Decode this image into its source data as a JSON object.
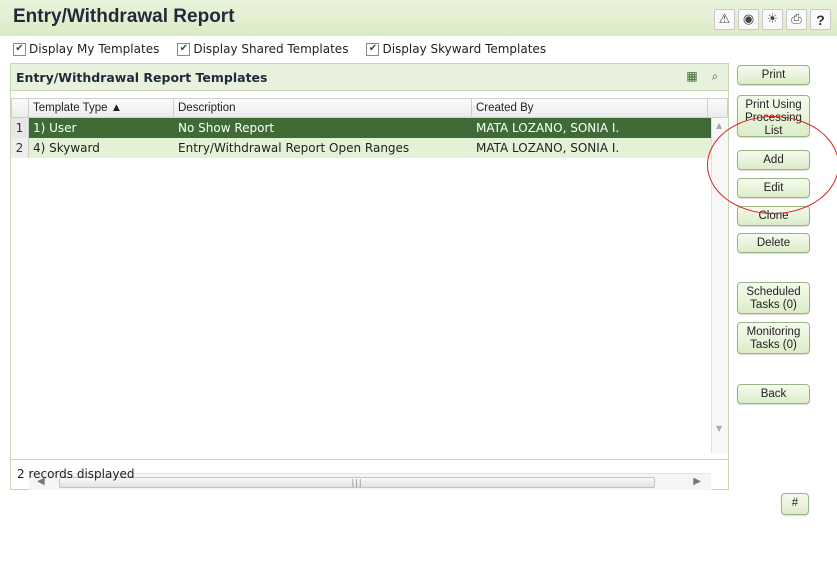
{
  "title": "Entry/Withdrawal Report",
  "toolbar_icons": [
    "alert-icon",
    "camera-icon",
    "lightbulb-icon",
    "printer-icon",
    "help-icon"
  ],
  "help_label": "?",
  "checkboxes": [
    {
      "label": "Display My Templates",
      "checked": true
    },
    {
      "label": "Display Shared Templates",
      "checked": true
    },
    {
      "label": "Display Skyward Templates",
      "checked": true
    }
  ],
  "panel": {
    "title": "Entry/Withdrawal Report Templates",
    "columns": [
      "Template Type ▲",
      "Description",
      "Created By"
    ],
    "rows": [
      {
        "num": "1",
        "type": "1) User",
        "description": "No Show Report",
        "created_by": "MATA LOZANO, SONIA I.",
        "selected": true
      },
      {
        "num": "2",
        "type": "4) Skyward",
        "description": "Entry/Withdrawal Report Open Ranges",
        "created_by": "MATA LOZANO, SONIA I.",
        "selected": false
      }
    ],
    "footer": "2 records displayed"
  },
  "buttons": {
    "print": "Print",
    "print_using": "Print Using Processing List",
    "add": "Add",
    "edit": "Edit",
    "clone": "Clone",
    "delete": "Delete",
    "scheduled": "Scheduled Tasks (0)",
    "monitoring": "Monitoring Tasks (0)",
    "back": "Back",
    "hash": "#"
  },
  "colors": {
    "selected_row": "#3f6b36",
    "alt_row": "#e3f2d6",
    "header_bg": "#e8f0de",
    "annotation": "#d92020"
  }
}
